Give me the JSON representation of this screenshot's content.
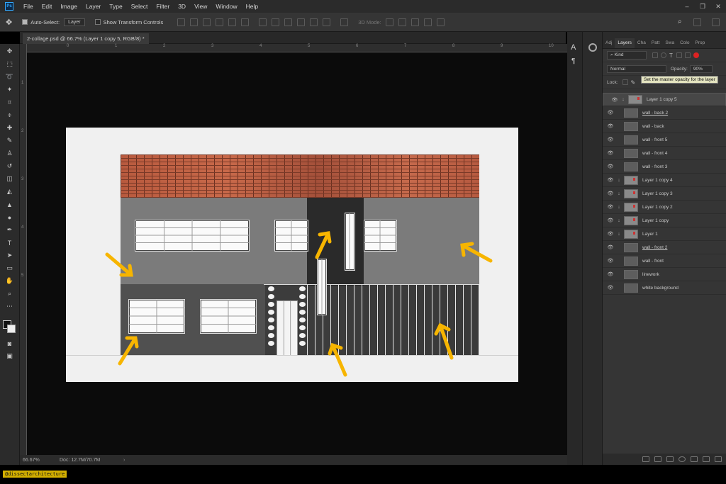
{
  "app": {
    "logo_text": "Ps"
  },
  "menubar": {
    "items": [
      "File",
      "Edit",
      "Image",
      "Layer",
      "Type",
      "Select",
      "Filter",
      "3D",
      "View",
      "Window",
      "Help"
    ]
  },
  "window_controls": [
    "–",
    "❐",
    "✕"
  ],
  "options_bar": {
    "auto_select_label": "Auto-Select:",
    "auto_select_value": "Layer",
    "transform_label": "Show Transform Controls",
    "mode_label": "3D Mode:"
  },
  "document": {
    "tab_title": "2-collage.psd @ 66.7% (Layer 1 copy 5, RGB/8) *"
  },
  "ruler": {
    "top_ticks": [
      "0",
      "1",
      "2",
      "3",
      "4",
      "5",
      "6",
      "7",
      "8",
      "9",
      "10",
      "11"
    ],
    "left_ticks": [
      "1",
      "2",
      "3",
      "4",
      "5"
    ]
  },
  "statusbar": {
    "zoom": "66.67%",
    "doc_info": "Doc: 12.7M/70.7M"
  },
  "panel": {
    "tabs": [
      "Adj",
      "Layers",
      "Cha",
      "Patt",
      "Swa",
      "Colo",
      "Prop"
    ],
    "active_tab": "Layers",
    "filter_kind": "Kind",
    "blend_mode": "Normal",
    "opacity_label": "Opacity:",
    "opacity_value": "90%",
    "lock_label": "Lock:",
    "tooltip": "Set the master opacity for the layer"
  },
  "layers": [
    {
      "name": "Layer 1 copy 5",
      "selected": true,
      "clipped": true,
      "underline": false
    },
    {
      "name": "wall - back 2",
      "selected": false,
      "clipped": false,
      "underline": true
    },
    {
      "name": "wall - back",
      "selected": false,
      "clipped": false,
      "underline": false
    },
    {
      "name": "wall - front 5",
      "selected": false,
      "clipped": false,
      "underline": false
    },
    {
      "name": "wall - front 4",
      "selected": false,
      "clipped": false,
      "underline": false
    },
    {
      "name": "wall - front 3",
      "selected": false,
      "clipped": false,
      "underline": false
    },
    {
      "name": "Layer 1 copy 4",
      "selected": false,
      "clipped": true,
      "underline": false
    },
    {
      "name": "Layer 1 copy 3",
      "selected": false,
      "clipped": true,
      "underline": false
    },
    {
      "name": "Layer 1 copy 2",
      "selected": false,
      "clipped": true,
      "underline": false
    },
    {
      "name": "Layer 1 copy",
      "selected": false,
      "clipped": true,
      "underline": false
    },
    {
      "name": "Layer 1",
      "selected": false,
      "clipped": true,
      "underline": false
    },
    {
      "name": "wall - front 2",
      "selected": false,
      "clipped": false,
      "underline": true
    },
    {
      "name": "wall - front",
      "selected": false,
      "clipped": false,
      "underline": false
    },
    {
      "name": "linework",
      "selected": false,
      "clipped": false,
      "underline": false
    },
    {
      "name": "white background",
      "selected": false,
      "clipped": false,
      "underline": false
    }
  ],
  "watermark": "@dissectarchitecture",
  "colors": {
    "accent_arrow": "#f7b500",
    "brick": "#b85a3e",
    "wall_grey": "#7b7b7b"
  }
}
